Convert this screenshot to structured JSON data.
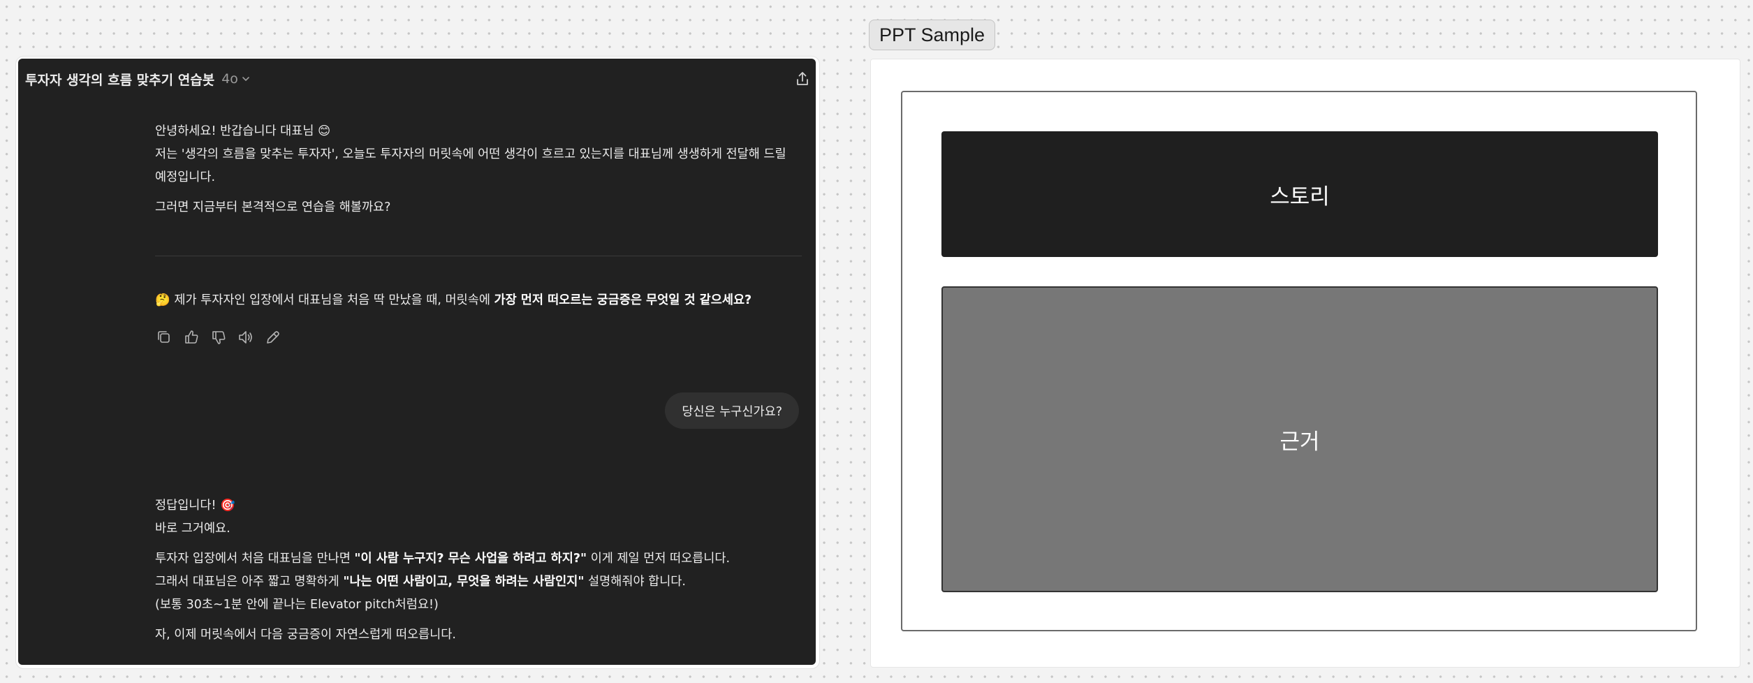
{
  "chat": {
    "title": "투자자 생각의 흐름 맞추기 연습봇",
    "model": "4o",
    "greeting": {
      "line1": "안녕하세요! 반갑습니다 대표님 😊",
      "line2a": "저는 '생각의 흐름을 맞추는 투자자', 오늘도 투자자의 머릿속에 어떤 생각이 흐르고 있는지를 대표님께 생생하게 전달해 드릴",
      "line2b": "예정입니다.",
      "line3": "그러면 지금부터 본격적으로 연습을 해볼까요?"
    },
    "question": {
      "prefix": "🤔 제가 투자자인 입장에서 대표님을 처음 딱 만났을 때, 머릿속에 ",
      "bold": "가장 먼저 떠오르는 궁금증은 무엇일 것 같으세요?"
    },
    "actions": [
      "copy-icon",
      "thumbs-up-icon",
      "thumbs-down-icon",
      "speaker-icon",
      "edit-icon"
    ],
    "user_message": "당신은 누구신가요?",
    "answer": {
      "line1": "정답입니다! 🎯",
      "line2": "바로 그거예요.",
      "line3_pre": "투자자 입장에서 처음 대표님을 만나면 ",
      "line3_bold": "\"이 사람 누구지? 무슨 사업을 하려고 하지?\"",
      "line3_post": " 이게 제일 먼저 떠오릅니다.",
      "line4_pre": "그래서 대표님은 아주 짧고 명확하게 ",
      "line4_bold": "\"나는 어떤 사람이고, 무엇을 하려는 사람인지\"",
      "line4_post": " 설명해줘야 합니다.",
      "line5": "(보통 30초~1분 안에 끝나는 Elevator pitch처럼요!)",
      "line6": "자, 이제 머릿속에서 다음 궁금증이 자연스럽게 떠오릅니다."
    }
  },
  "ppt": {
    "label": "PPT Sample",
    "story_label": "스토리",
    "evidence_label": "근거"
  },
  "colors": {
    "chat_bg": "#212121",
    "bubble_bg": "#303030",
    "story_block": "#1f1f1f",
    "evidence_block": "#777777"
  }
}
